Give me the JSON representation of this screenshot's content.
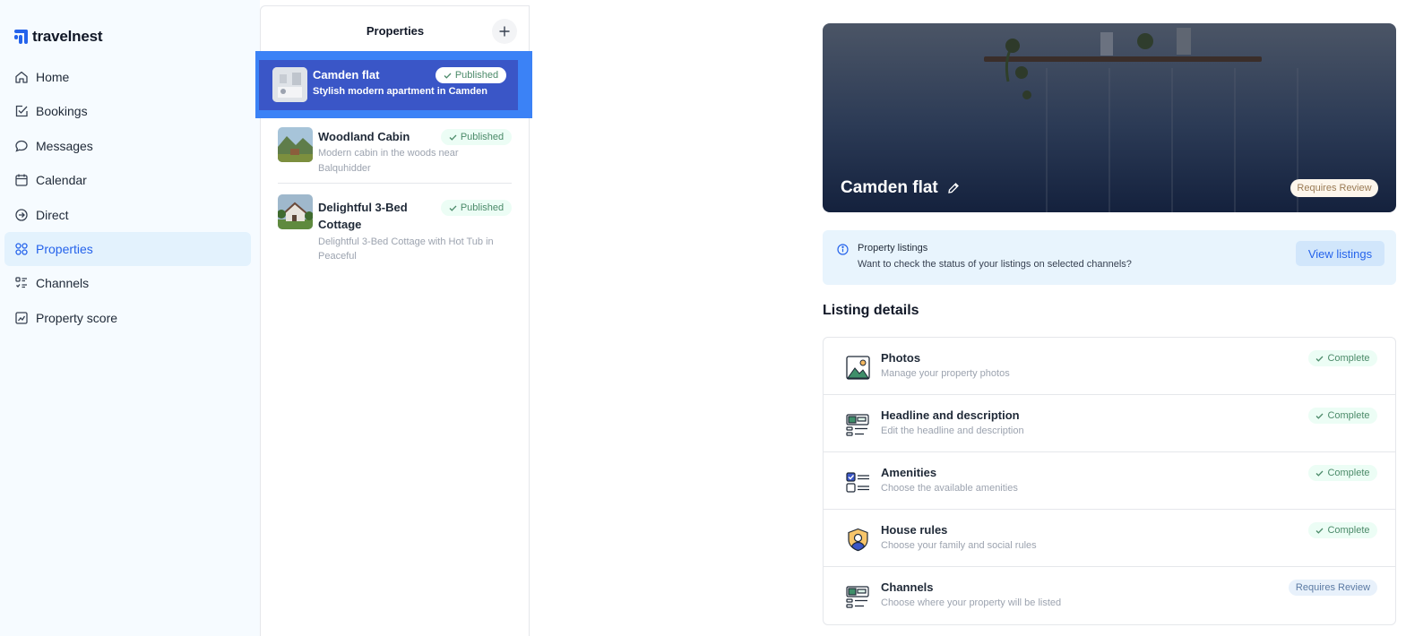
{
  "app": {
    "logo_text": "travelnest"
  },
  "sidebar": {
    "items": [
      {
        "label": "Home",
        "icon": "home-icon"
      },
      {
        "label": "Bookings",
        "icon": "checkbox-icon"
      },
      {
        "label": "Messages",
        "icon": "chat-bubble-icon"
      },
      {
        "label": "Calendar",
        "icon": "calendar-icon"
      },
      {
        "label": "Direct",
        "icon": "arrow-circle-icon"
      },
      {
        "label": "Properties",
        "icon": "grid-icon",
        "active": true
      },
      {
        "label": "Channels",
        "icon": "list-icon"
      },
      {
        "label": "Property score",
        "icon": "chart-icon"
      }
    ]
  },
  "properties": {
    "title": "Properties",
    "items": [
      {
        "name": "Camden flat",
        "description": "Stylish modern apartment in Camden",
        "status": "Published",
        "selected": true
      },
      {
        "name": "Woodland Cabin",
        "description_line1": "Modern cabin in the woods near",
        "description_line2": "Balquhidder",
        "status": "Published"
      },
      {
        "name_line1": "Delightful 3-Bed",
        "name_line2": "Cottage",
        "description_line1": "Delightful 3-Bed Cottage with Hot Tub in",
        "description_line2": "Peaceful",
        "status": "Published"
      }
    ]
  },
  "hero": {
    "title": "Camden flat",
    "badge": "Requires Review"
  },
  "info": {
    "title": "Property listings",
    "text": "Want to check the status of your listings on selected channels?",
    "button": "View listings"
  },
  "listing_details": {
    "title": "Listing details",
    "rows": [
      {
        "title": "Photos",
        "subtitle": "Manage your property photos",
        "status": "Complete"
      },
      {
        "title": "Headline and description",
        "subtitle": "Edit the headline and description",
        "status": "Complete"
      },
      {
        "title": "Amenities",
        "subtitle": "Choose the available amenities",
        "status": "Complete"
      },
      {
        "title": "House rules",
        "subtitle": "Choose your family and social rules",
        "status": "Complete"
      },
      {
        "title": "Channels",
        "subtitle": "Choose where your property will be listed",
        "status": "Requires Review"
      }
    ]
  },
  "colors": {
    "accent": "#2563eb",
    "selected": "#3a56c7",
    "sidebar_bg": "#f6fbff",
    "complete_bg": "#ecfdf5"
  }
}
